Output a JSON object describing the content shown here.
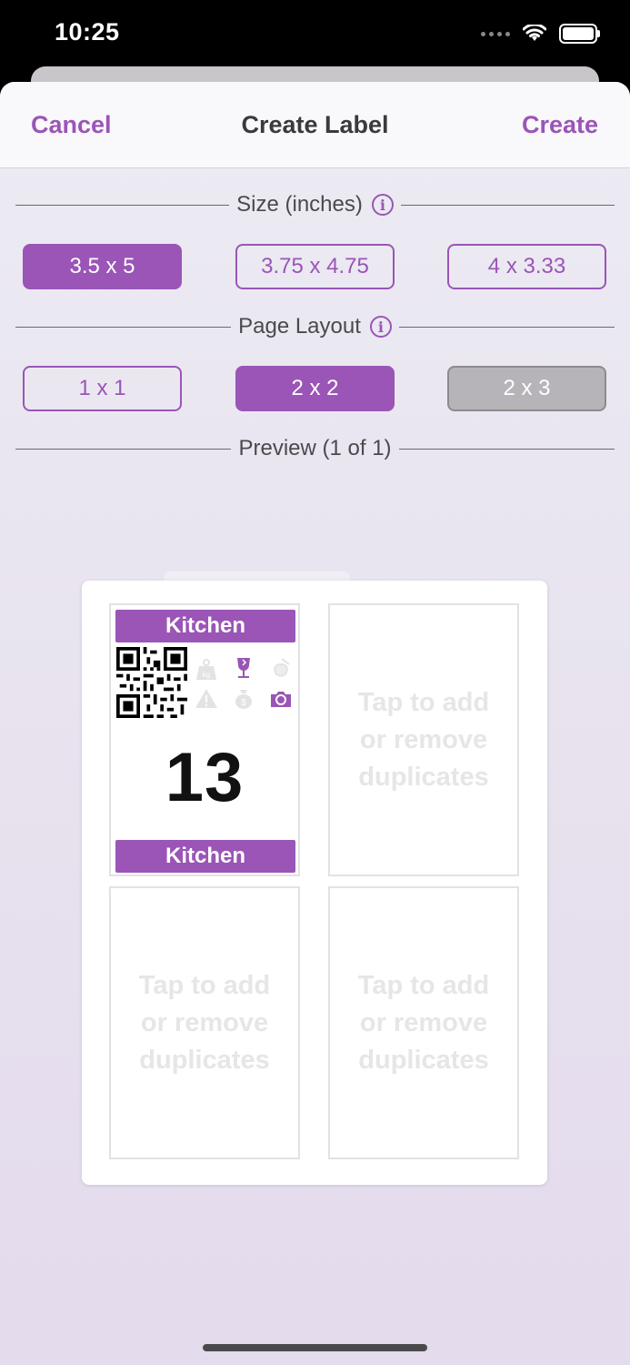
{
  "status_bar": {
    "time": "10:25"
  },
  "nav": {
    "cancel_label": "Cancel",
    "title": "Create Label",
    "create_label": "Create"
  },
  "size_section": {
    "title": "Size (inches)",
    "options": [
      "3.5 x 5",
      "3.75 x 4.75",
      "4 x 3.33"
    ],
    "selected": "3.5 x 5"
  },
  "layout_section": {
    "title": "Page Layout",
    "options": [
      "1 x 1",
      "2 x 2",
      "2 x 3"
    ],
    "selected": "2 x 2",
    "disabled": [
      "2 x 3"
    ]
  },
  "preview": {
    "title": "Preview (1 of 1)",
    "label": {
      "location": "Kitchen",
      "number": "13"
    },
    "placeholder": "Tap to add or remove duplicates"
  },
  "colors": {
    "accent": "#9a55b6",
    "disabled": "#b6b4b8",
    "icon_faded": "#e3e3e6"
  }
}
